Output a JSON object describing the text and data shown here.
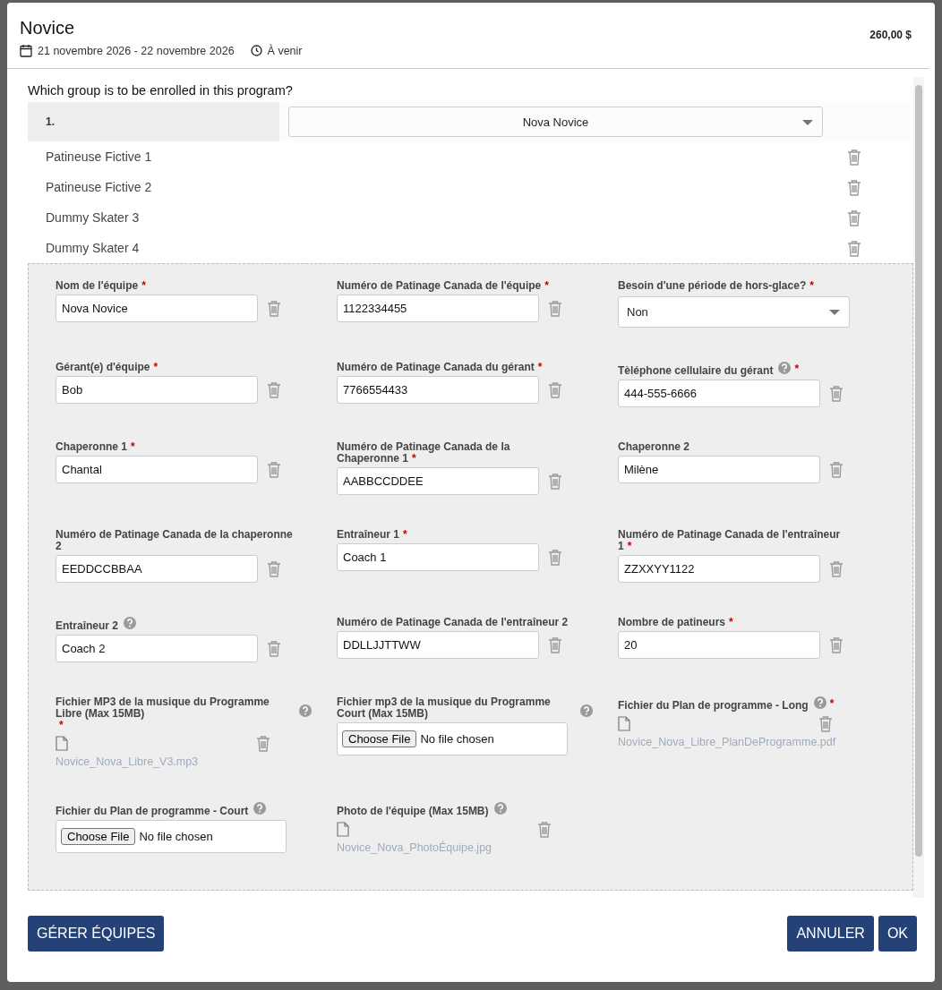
{
  "header": {
    "title": "Novice",
    "dates": "21 novembre 2026 - 22 novembre 2026",
    "status": "À venir",
    "price": "260,00 $"
  },
  "question": "Which group is to be enrolled in this program?",
  "group": {
    "index": "1.",
    "value": "Nova Novice"
  },
  "skaters": [
    {
      "name": "Patineuse Fictive 1"
    },
    {
      "name": "Patineuse Fictive 2"
    },
    {
      "name": "Dummy Skater 3"
    },
    {
      "name": "Dummy Skater 4"
    }
  ],
  "fields": [
    {
      "kind": "text",
      "label": "Nom de l'équipe",
      "required_mark": "*",
      "help": false,
      "value": "Nova Novice",
      "deletable": true
    },
    {
      "kind": "text",
      "label": "Numéro de Patinage Canada de l'équipe",
      "required_mark": "*",
      "help": false,
      "value": "1122334455",
      "deletable": true
    },
    {
      "kind": "select",
      "label": "Besoin d'une période de hors-glace?",
      "required_mark": "*",
      "help": false,
      "value": "Non",
      "deletable": false
    },
    {
      "kind": "text",
      "label": "Gérant(e) d'équipe",
      "required_mark": "*",
      "help": false,
      "value": "Bob",
      "deletable": true
    },
    {
      "kind": "text",
      "label": "Numéro de Patinage Canada du gérant",
      "required_mark": "*",
      "help": false,
      "value": "7766554433",
      "deletable": true
    },
    {
      "kind": "text",
      "label": "Tèléphone cellulaire du gérant",
      "required_mark": "*",
      "help": true,
      "value": "444-555-6666",
      "deletable": true
    },
    {
      "kind": "text",
      "label": "Chaperonne 1",
      "required_mark": "*",
      "help": false,
      "value": "Chantal",
      "deletable": true
    },
    {
      "kind": "text",
      "label": "Numéro de Patinage Canada de la Chaperonne 1",
      "required_mark": "*",
      "help": false,
      "value": "AABBCCDDEE",
      "deletable": true
    },
    {
      "kind": "text",
      "label": "Chaperonne 2",
      "help": false,
      "value": "Milène",
      "deletable": true
    },
    {
      "kind": "text",
      "label": "Numéro de Patinage Canada de la chaperonne 2",
      "help": false,
      "value": "EEDDCCBBAA",
      "deletable": true
    },
    {
      "kind": "text",
      "label": "Entraîneur 1",
      "required_mark": "*",
      "help": false,
      "value": "Coach 1",
      "deletable": true
    },
    {
      "kind": "text",
      "label": "Numéro de Patinage Canada de l'entraîneur 1",
      "required_mark": "*",
      "help": false,
      "value": "ZZXXYY1122",
      "deletable": true
    },
    {
      "kind": "text",
      "label": "Entraîneur 2",
      "help": true,
      "value": "Coach 2",
      "deletable": true
    },
    {
      "kind": "text",
      "label": "Numéro de Patinage Canada de l'entraîneur 2",
      "help": false,
      "value": "DDLLJJTTWW",
      "deletable": true
    },
    {
      "kind": "text",
      "label": "Nombre de patineurs",
      "required_mark": "*",
      "help": false,
      "value": "20",
      "deletable": true
    },
    {
      "kind": "uploaded",
      "label": "Fichier MP3 de la musique du Programme Libre (Max 15MB)",
      "required_mark": "*",
      "help": true,
      "filename": "Novice_Nova_Libre_V3.mp3",
      "deletable": true
    },
    {
      "kind": "file",
      "label": "Fichier mp3 de la musique du Programme Court (Max 15MB)",
      "help": true,
      "button": "Choose File",
      "status": "No file chosen",
      "deletable": false
    },
    {
      "kind": "uploaded",
      "label": "Fichier du Plan de programme - Long",
      "required_mark": "*",
      "help": true,
      "filename": "Novice_Nova_Libre_PlanDeProgramme.pdf",
      "deletable": true
    },
    {
      "kind": "file",
      "label": "Fichier du Plan de programme - Court",
      "help": true,
      "button": "Choose File",
      "status": "No file chosen",
      "deletable": false
    },
    {
      "kind": "uploaded",
      "label": "Photo de l'équipe (Max 15MB)",
      "help": true,
      "filename": "Novice_Nova_PhotoÉquipe.jpg",
      "deletable": true
    }
  ],
  "footer": {
    "manage": "GÉRER ÉQUIPES",
    "cancel": "ANNULER",
    "ok": "OK"
  }
}
